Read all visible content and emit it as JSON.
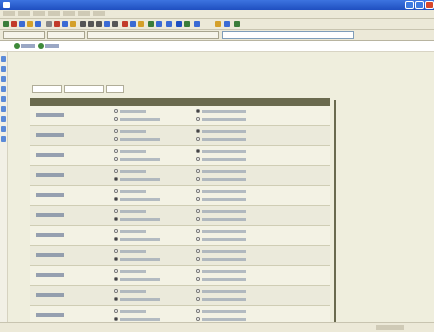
{
  "window": {
    "title": ""
  },
  "menu": {
    "items": [
      "",
      "",
      "",
      "",
      "",
      "",
      ""
    ]
  },
  "addressbar": {
    "tabs": [
      "",
      "",
      ""
    ],
    "url": "",
    "go_label": ""
  },
  "linkbar": {
    "links": [
      "",
      ""
    ]
  },
  "page": {
    "title": "",
    "subtabs": [
      "",
      "",
      ""
    ],
    "table": {
      "headers": [
        "",
        ""
      ],
      "rows": [
        {
          "label": "",
          "options": [
            "",
            "",
            "",
            ""
          ],
          "selected": 2
        },
        {
          "label": "",
          "options": [
            "",
            "",
            "",
            ""
          ],
          "selected": 2
        },
        {
          "label": "",
          "options": [
            "",
            "",
            "",
            ""
          ],
          "selected": 2
        },
        {
          "label": "",
          "options": [
            "",
            "",
            "",
            ""
          ],
          "selected": 1
        },
        {
          "label": "",
          "options": [
            "",
            "",
            "",
            ""
          ],
          "selected": 1
        },
        {
          "label": "",
          "options": [
            "",
            "",
            "",
            ""
          ],
          "selected": 1
        },
        {
          "label": "",
          "options": [
            "",
            "",
            "",
            ""
          ],
          "selected": 1
        },
        {
          "label": "",
          "options": [
            "",
            "",
            "",
            ""
          ],
          "selected": 1
        },
        {
          "label": "",
          "options": [
            "",
            "",
            "",
            ""
          ],
          "selected": 1
        },
        {
          "label": "",
          "options": [
            "",
            "",
            "",
            ""
          ],
          "selected": 1
        },
        {
          "label": "",
          "options": [
            "",
            "",
            "",
            ""
          ],
          "selected": 1
        }
      ]
    }
  },
  "status": {
    "text": "",
    "zone": ""
  },
  "colors": {
    "title_bar": "#2a5fd0",
    "page_title": "#b83a2a",
    "header_bar": "#6a6a4e",
    "content_bg": "#efeedd"
  }
}
